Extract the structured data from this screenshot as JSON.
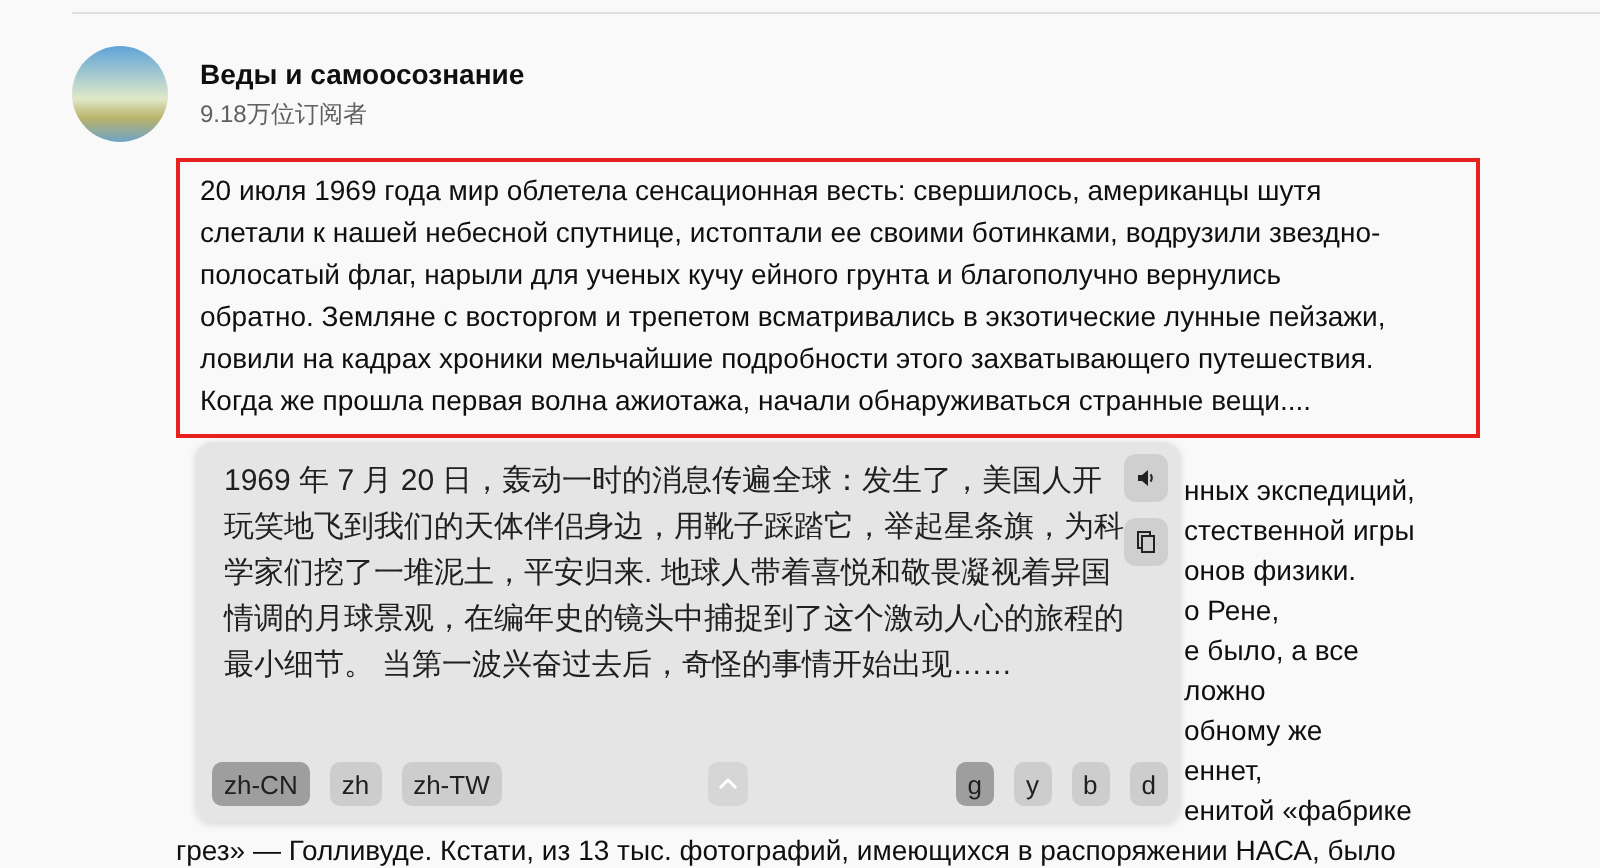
{
  "channel": {
    "name": "Веды и самоосознание",
    "subscribers": "9.18万位订阅者"
  },
  "highlighted_paragraph": "20 июля 1969 года мир облетела сенсационная весть: свершилось, американцы шутя слетали к нашей небесной спутнице, истоптали ее своими ботинками, водрузили звездно-полосатый флаг, нарыли для ученых кучу ейного грунта и благополучно вернулись обратно. Земляне с восторгом и трепетом всматривались в экзотические лунные пейзажи, ловили на кадрах хроники мельчайшие подробности этого захватывающего путешествия. Когда же прошла первая волна ажиотажа, начали обнаруживаться странные вещи....",
  "background_lines": [
    "нных экспедиций,",
    "стественной игры",
    "онов физики.",
    "о Рене,",
    "е было, а все",
    "ложно",
    "обному же",
    "еннет,",
    "енитой «фабрике"
  ],
  "next_line": "грез» — Голливуде. Кстати, из 13 тыс. фотографий, имеющихся в распоряжении НАСА, было",
  "translation_popup": {
    "text": "1969 年 7 月 20 日，轰动一时的消息传遍全球：发生了，美国人开玩笑地飞到我们的天体伴侣身边，用靴子踩踏它，举起星条旗，为科学家们挖了一堆泥土，平安归来. 地球人带着喜悦和敬畏凝视着异国情调的月球景观，在编年史的镜头中捕捉到了这个激动人心的旅程的最小细节。 当第一波兴奋过去后，奇怪的事情开始出现……",
    "languages": [
      {
        "label": "zh-CN",
        "selected": true
      },
      {
        "label": "zh",
        "selected": false
      },
      {
        "label": "zh-TW",
        "selected": false
      }
    ],
    "engines": [
      {
        "label": "g",
        "selected": true
      },
      {
        "label": "y",
        "selected": false
      },
      {
        "label": "b",
        "selected": false
      },
      {
        "label": "d",
        "selected": false
      }
    ]
  }
}
